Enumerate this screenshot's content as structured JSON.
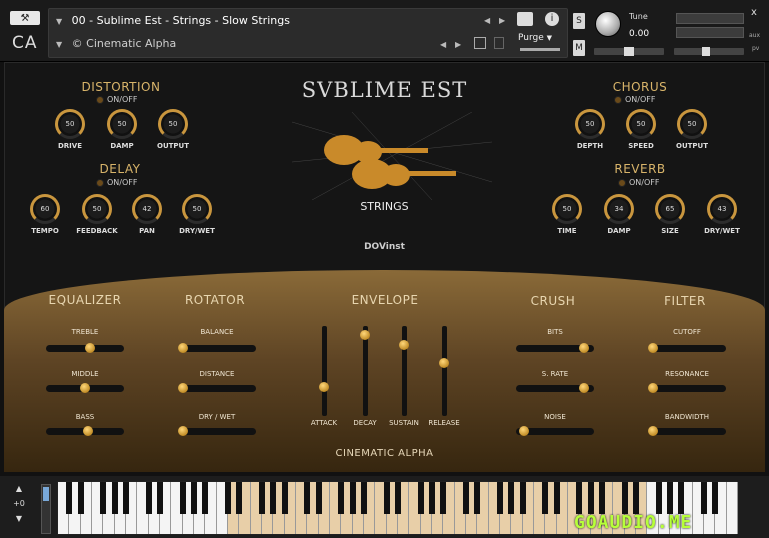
{
  "header": {
    "logo": "CA",
    "instrument_name": "00 - Sublime Est - Strings - Slow Strings",
    "library_name": "© Cinematic Alpha",
    "purge_label": "Purge",
    "s_label": "S",
    "m_label": "M",
    "tune_label": "Tune",
    "tune_value": "0.00",
    "close": "x",
    "aux": "aux",
    "pv": "pv"
  },
  "main": {
    "title": "SVBLIME EST",
    "subtitle": "STRINGS",
    "brand": "DOVinst",
    "footer": "CINEMATIC ALPHA",
    "onoff": "ON/OFF",
    "distortion": {
      "title": "DISTORTION",
      "knobs": [
        {
          "label": "DRIVE",
          "value": "50"
        },
        {
          "label": "DAMP",
          "value": "50"
        },
        {
          "label": "OUTPUT",
          "value": "50"
        }
      ]
    },
    "delay": {
      "title": "DELAY",
      "knobs": [
        {
          "label": "TEMPO",
          "value": "60"
        },
        {
          "label": "FEEDBACK",
          "value": "50"
        },
        {
          "label": "PAN",
          "value": "42"
        },
        {
          "label": "DRY/WET",
          "value": "50"
        }
      ]
    },
    "chorus": {
      "title": "CHORUS",
      "knobs": [
        {
          "label": "DEPTH",
          "value": "50"
        },
        {
          "label": "SPEED",
          "value": "50"
        },
        {
          "label": "OUTPUT",
          "value": "50"
        }
      ]
    },
    "reverb": {
      "title": "REVERB",
      "knobs": [
        {
          "label": "TIME",
          "value": "50"
        },
        {
          "label": "DAMP",
          "value": "34"
        },
        {
          "label": "SIZE",
          "value": "65"
        },
        {
          "label": "DRY/WET",
          "value": "43"
        }
      ]
    },
    "equalizer": {
      "title": "EQUALIZER",
      "sliders": [
        {
          "label": "TREBLE",
          "value": 0.58
        },
        {
          "label": "MIDDLE",
          "value": 0.5
        },
        {
          "label": "BASS",
          "value": 0.55
        }
      ]
    },
    "rotator": {
      "title": "ROTATOR",
      "sliders": [
        {
          "label": "BALANCE",
          "value": 0.0
        },
        {
          "label": "DISTANCE",
          "value": 0.0
        },
        {
          "label": "DRY / WET",
          "value": 0.0
        }
      ]
    },
    "envelope": {
      "title": "ENVELOPE",
      "sliders": [
        {
          "label": "ATTACK",
          "value": 0.3
        },
        {
          "label": "DECAY",
          "value": 0.95
        },
        {
          "label": "SUSTAIN",
          "value": 0.82
        },
        {
          "label": "RELEASE",
          "value": 0.6
        }
      ]
    },
    "crush": {
      "title": "CRUSH",
      "sliders": [
        {
          "label": "BITS",
          "value": 0.92
        },
        {
          "label": "S. RATE",
          "value": 0.92
        },
        {
          "label": "NOISE",
          "value": 0.05
        }
      ]
    },
    "filter": {
      "title": "FILTER",
      "sliders": [
        {
          "label": "CUTOFF",
          "value": 0.0
        },
        {
          "label": "RESONANCE",
          "value": 0.0
        },
        {
          "label": "BANDWIDTH",
          "value": 0.0
        }
      ]
    }
  },
  "keyboard": {
    "octave": "+0"
  },
  "watermark": "GOAUDIO.ME"
}
